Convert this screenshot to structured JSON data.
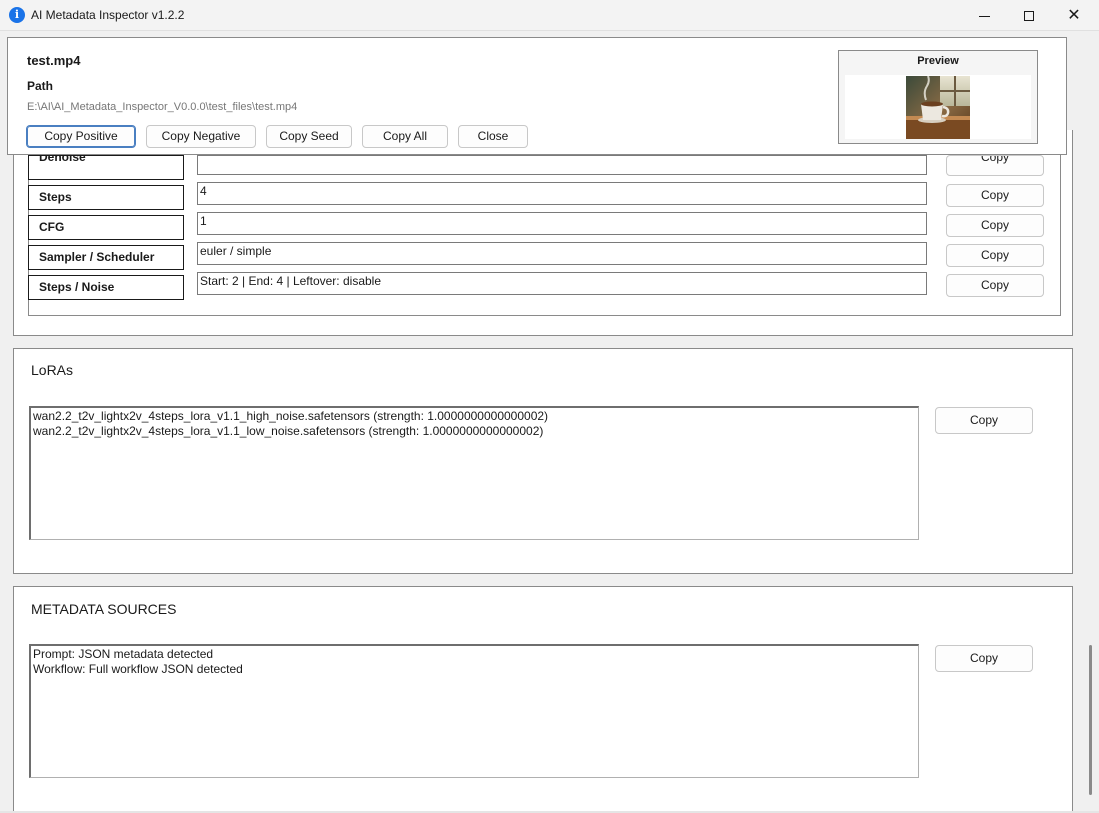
{
  "window": {
    "title": "AI Metadata Inspector v1.2.2",
    "icon": "info-icon",
    "controls": {
      "minimize": "minimize-icon",
      "maximize": "maximize-icon",
      "close": "close-icon"
    }
  },
  "header": {
    "file_name": "test.mp4",
    "path_label": "Path",
    "path_value": "E:\\AI\\AI_Metadata_Inspector_V0.0.0\\test_files\\test.mp4",
    "buttons": {
      "copy_positive": "Copy Positive",
      "copy_negative": "Copy Negative",
      "copy_seed": "Copy Seed",
      "copy_all": "Copy All",
      "close": "Close"
    },
    "preview_label": "Preview"
  },
  "params": {
    "partial_label": "Denoise",
    "partial_copy": "Copy",
    "rows": [
      {
        "label": "Steps",
        "value": "4",
        "copy": "Copy"
      },
      {
        "label": "CFG",
        "value": "1",
        "copy": "Copy"
      },
      {
        "label": "Sampler / Scheduler",
        "value": "euler / simple",
        "copy": "Copy"
      },
      {
        "label": "Steps / Noise",
        "value": "Start: 2 | End: 4 | Leftover: disable",
        "copy": "Copy"
      }
    ]
  },
  "loras": {
    "title": "LoRAs",
    "lines": [
      "wan2.2_t2v_lightx2v_4steps_lora_v1.1_high_noise.safetensors (strength: 1.0000000000000002)",
      "wan2.2_t2v_lightx2v_4steps_lora_v1.1_low_noise.safetensors (strength: 1.0000000000000002)"
    ],
    "copy": "Copy"
  },
  "metadata_sources": {
    "title": "METADATA SOURCES",
    "lines": [
      "Prompt: JSON metadata detected",
      "Workflow: Full workflow JSON detected"
    ],
    "copy": "Copy"
  }
}
